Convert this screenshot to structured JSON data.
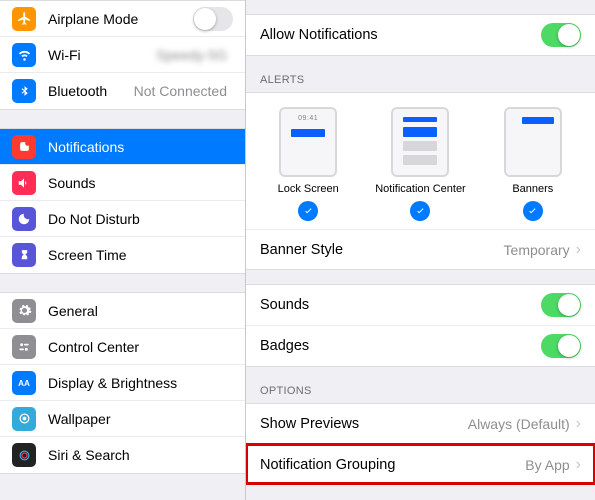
{
  "sidebar": {
    "group1": [
      {
        "key": "airplane",
        "label": "Airplane Mode",
        "switch": false
      },
      {
        "key": "wifi",
        "label": "Wi-Fi",
        "value": "Speedy-5G"
      },
      {
        "key": "bluetooth",
        "label": "Bluetooth",
        "value": "Not Connected"
      }
    ],
    "group2": [
      {
        "key": "notifications",
        "label": "Notifications",
        "selected": true
      },
      {
        "key": "sounds",
        "label": "Sounds"
      },
      {
        "key": "dnd",
        "label": "Do Not Disturb"
      },
      {
        "key": "screentime",
        "label": "Screen Time"
      }
    ],
    "group3": [
      {
        "key": "general",
        "label": "General"
      },
      {
        "key": "controlcenter",
        "label": "Control Center"
      },
      {
        "key": "display",
        "label": "Display & Brightness"
      },
      {
        "key": "wallpaper",
        "label": "Wallpaper"
      },
      {
        "key": "siri",
        "label": "Siri & Search"
      }
    ]
  },
  "main": {
    "allow_label": "Allow Notifications",
    "allow_on": true,
    "alerts_header": "ALERTS",
    "alert_options": [
      {
        "key": "lock",
        "name": "Lock Screen",
        "checked": true,
        "time": "09:41"
      },
      {
        "key": "nc",
        "name": "Notification Center",
        "checked": true
      },
      {
        "key": "banners",
        "name": "Banners",
        "checked": true
      }
    ],
    "banner_style": {
      "label": "Banner Style",
      "value": "Temporary"
    },
    "sounds": {
      "label": "Sounds",
      "on": true
    },
    "badges": {
      "label": "Badges",
      "on": true
    },
    "options_header": "OPTIONS",
    "show_previews": {
      "label": "Show Previews",
      "value": "Always (Default)"
    },
    "notification_grouping": {
      "label": "Notification Grouping",
      "value": "By App"
    }
  },
  "colors": {
    "accent": "#007aff",
    "green": "#4cd964",
    "highlight": "#d80000"
  }
}
